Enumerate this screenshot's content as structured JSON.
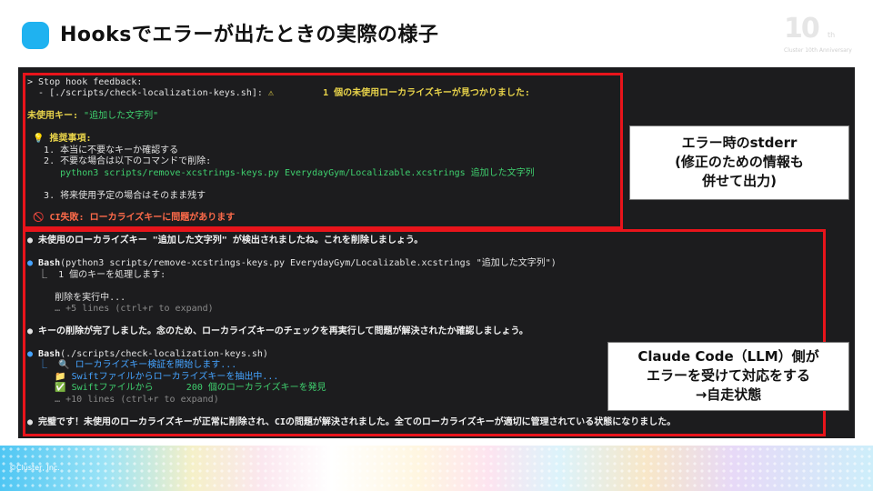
{
  "slide": {
    "title": "Hooksでエラーが出たときの実際の様子",
    "copyright": "©Cluster, Inc.",
    "anniversary": {
      "number": "10",
      "suffix": "th",
      "caption": "Cluster 10th Anniversary"
    }
  },
  "terminal": {
    "lines": [
      {
        "id": "l1",
        "parts": [
          {
            "t": "> Stop hook feedback:",
            "c": "w"
          }
        ]
      },
      {
        "id": "l2",
        "parts": [
          {
            "t": "  - [./scripts/check-localization-keys.sh]: ",
            "c": "w"
          },
          {
            "t": "⚠",
            "c": "y"
          },
          {
            "t": "         1 個の未使用ローカライズキーが見つかりました:",
            "c": "y"
          }
        ]
      },
      {
        "id": "l3",
        "parts": [
          {
            "t": "",
            "c": "w"
          }
        ]
      },
      {
        "id": "l4",
        "parts": [
          {
            "t": "未使用キー: ",
            "c": "y"
          },
          {
            "t": "\"追加した文字列\"",
            "c": "g"
          }
        ]
      },
      {
        "id": "l5",
        "parts": [
          {
            "t": "",
            "c": "w"
          }
        ]
      },
      {
        "id": "l6",
        "parts": [
          {
            "t": " 💡 ",
            "c": "y"
          },
          {
            "t": "推奨事項:",
            "c": "y"
          }
        ]
      },
      {
        "id": "l7",
        "parts": [
          {
            "t": "   1. 本当に不要なキーか確認する",
            "c": "w"
          }
        ]
      },
      {
        "id": "l8",
        "parts": [
          {
            "t": "   2. 不要な場合は以下のコマンドで削除:",
            "c": "w"
          }
        ]
      },
      {
        "id": "l9",
        "parts": [
          {
            "t": "      python3 scripts/remove-xcstrings-keys.py EverydayGym/Localizable.xcstrings 追加した文字列",
            "c": "g"
          }
        ]
      },
      {
        "id": "l10",
        "parts": [
          {
            "t": "",
            "c": "w"
          }
        ]
      },
      {
        "id": "l11",
        "parts": [
          {
            "t": "   3. 将来使用予定の場合はそのまま残す",
            "c": "w"
          }
        ]
      },
      {
        "id": "l12",
        "parts": [
          {
            "t": "",
            "c": "w"
          }
        ]
      },
      {
        "id": "l13",
        "parts": [
          {
            "t": " 🚫 ",
            "c": "r"
          },
          {
            "t": "CI失敗: ローカライズキーに問題があります",
            "c": "r"
          }
        ]
      },
      {
        "id": "l14",
        "parts": [
          {
            "t": "",
            "c": "w"
          }
        ]
      },
      {
        "id": "l15",
        "parts": [
          {
            "t": "● ",
            "c": "w"
          },
          {
            "t": "未使用のローカライズキー \"追加した文字列\" が検出されましたね。これを削除しましょう。",
            "c": "wb"
          }
        ]
      },
      {
        "id": "l16",
        "parts": [
          {
            "t": "",
            "c": "w"
          }
        ]
      },
      {
        "id": "l17",
        "parts": [
          {
            "t": "● ",
            "c": "b"
          },
          {
            "t": "Bash",
            "c": "wb"
          },
          {
            "t": "(python3 scripts/remove-xcstrings-keys.py EverydayGym/Localizable.xcstrings \"追加した文字列\")",
            "c": "w"
          }
        ]
      },
      {
        "id": "l18",
        "parts": [
          {
            "t": "  ⎿  1 個のキーを処理します:",
            "c": "w"
          }
        ]
      },
      {
        "id": "l19",
        "parts": [
          {
            "t": "",
            "c": "w"
          }
        ]
      },
      {
        "id": "l20",
        "parts": [
          {
            "t": "     削除を実行中...",
            "c": "w"
          }
        ]
      },
      {
        "id": "l21",
        "parts": [
          {
            "t": "     … +5 lines (ctrl+r to expand)",
            "c": "dim"
          }
        ]
      },
      {
        "id": "l22",
        "parts": [
          {
            "t": "",
            "c": "w"
          }
        ]
      },
      {
        "id": "l23",
        "parts": [
          {
            "t": "● ",
            "c": "w"
          },
          {
            "t": "キーの削除が完了しました。念のため、ローカライズキーのチェックを再実行して問題が解決されたか確認しましょう。",
            "c": "wb"
          }
        ]
      },
      {
        "id": "l24",
        "parts": [
          {
            "t": "",
            "c": "w"
          }
        ]
      },
      {
        "id": "l25",
        "parts": [
          {
            "t": "● ",
            "c": "b"
          },
          {
            "t": "Bash",
            "c": "wb"
          },
          {
            "t": "(./scripts/check-localization-keys.sh)",
            "c": "w"
          }
        ]
      },
      {
        "id": "l26",
        "parts": [
          {
            "t": "  ⎿  🔍 ",
            "c": "b"
          },
          {
            "t": "ローカライズキー検証を開始します...",
            "c": "b"
          }
        ]
      },
      {
        "id": "l27",
        "parts": [
          {
            "t": "     📁 ",
            "c": "b"
          },
          {
            "t": "Swiftファイルからローカライズキーを抽出中...",
            "c": "b"
          }
        ]
      },
      {
        "id": "l28",
        "parts": [
          {
            "t": "     ✅ ",
            "c": "g"
          },
          {
            "t": "Swiftファイルから      200 個のローカライズキーを発見",
            "c": "g"
          }
        ]
      },
      {
        "id": "l29",
        "parts": [
          {
            "t": "     … +10 lines (ctrl+r to expand)",
            "c": "dim"
          }
        ]
      },
      {
        "id": "l30",
        "parts": [
          {
            "t": "",
            "c": "w"
          }
        ]
      },
      {
        "id": "l31",
        "parts": [
          {
            "t": "● ",
            "c": "w"
          },
          {
            "t": "完璧です！未使用のローカライズキーが正常に削除され、CIの問題が解決されました。全てのローカライズキーが適切に管理されている状態になりました。",
            "c": "wb"
          }
        ]
      }
    ]
  },
  "callouts": {
    "stderr": {
      "line1": "エラー時のstderr",
      "line2": "(修正のための情報も",
      "line3": "併せて出力)"
    },
    "claude": {
      "line1": "Claude Code（LLM）側が",
      "line2": "エラーを受けて対応をする",
      "line3": "→自走状態"
    }
  },
  "colors": {
    "accent": "#1fb2f0",
    "highlight": "#e8141b",
    "terminal_bg": "#1c1c1e"
  }
}
